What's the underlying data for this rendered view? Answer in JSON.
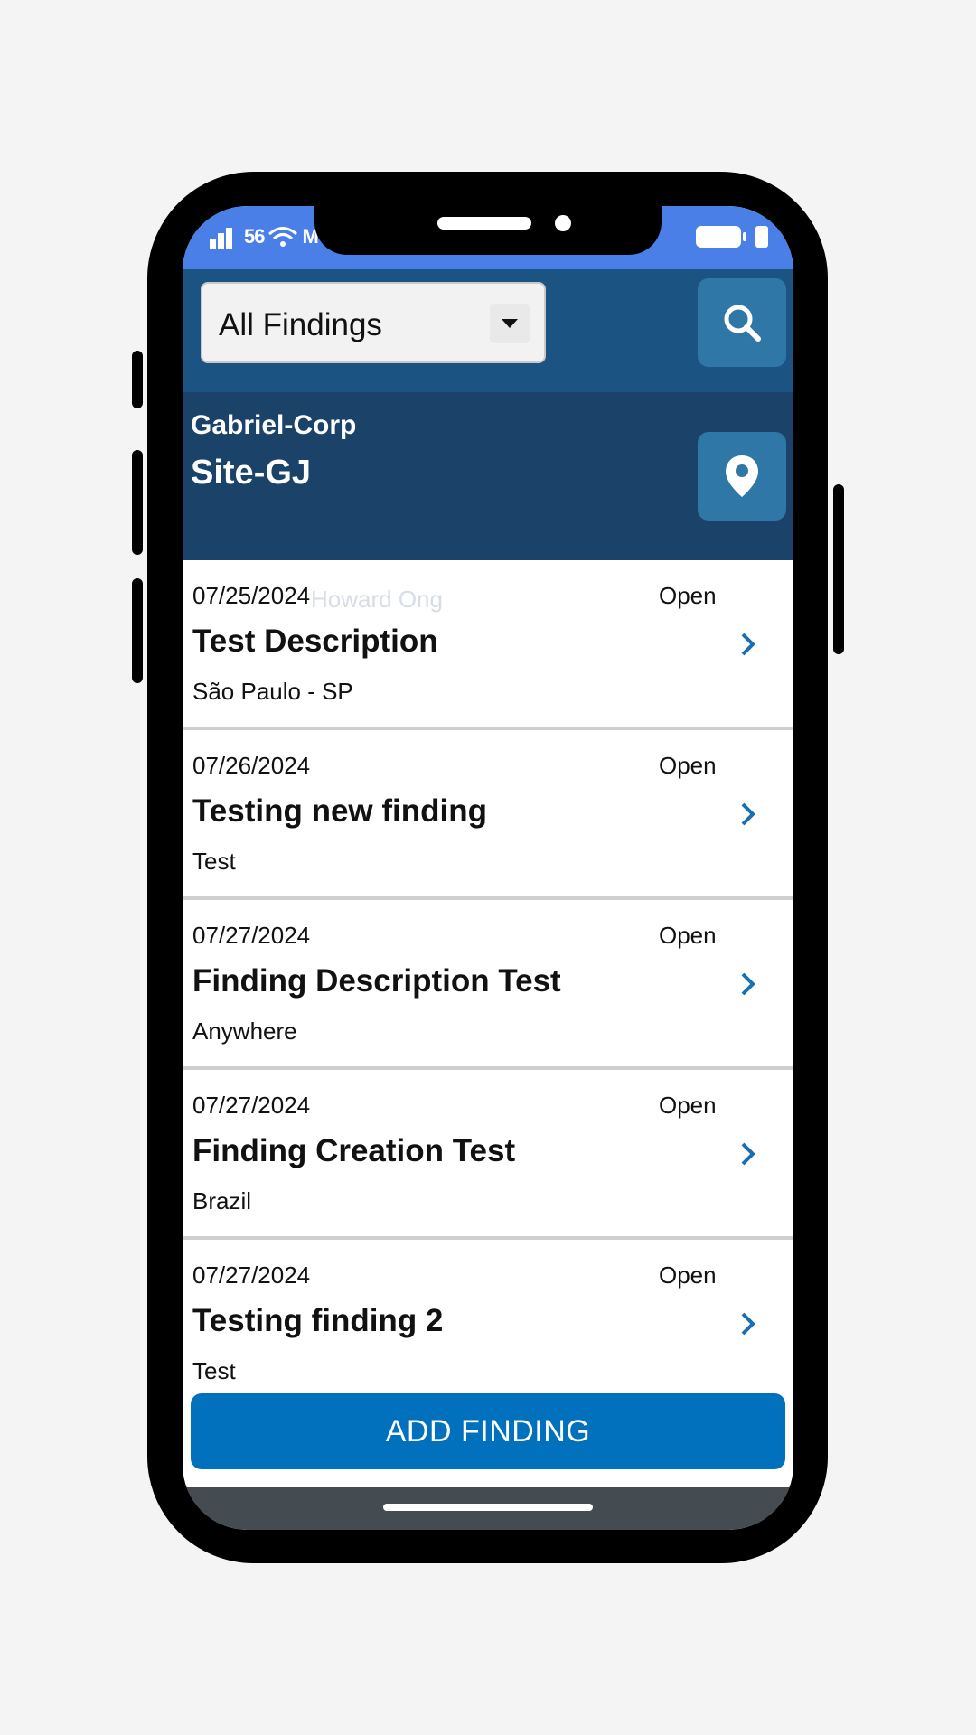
{
  "status_bar": {
    "time_fragment": "56",
    "network": "M"
  },
  "header": {
    "filter": {
      "selected": "All Findings"
    },
    "search_icon": "search-icon",
    "company": "Gabriel-Corp",
    "site": "Site-GJ",
    "location_icon": "map-pin-icon"
  },
  "findings": [
    {
      "date": "07/25/2024",
      "status": "Open",
      "title": "Test Description",
      "location": "São Paulo - SP"
    },
    {
      "date": "07/26/2024",
      "status": "Open",
      "title": "Testing new finding",
      "location": "Test"
    },
    {
      "date": "07/27/2024",
      "status": "Open",
      "title": "Finding Description Test",
      "location": "Anywhere"
    },
    {
      "date": "07/27/2024",
      "status": "Open",
      "title": "Finding Creation Test",
      "location": "Brazil"
    },
    {
      "date": "07/27/2024",
      "status": "Open",
      "title": "Testing finding 2",
      "location": "Test"
    }
  ],
  "watermark": "Howard Ong",
  "actions": {
    "add_finding": "ADD FINDING"
  },
  "colors": {
    "primary": "#0171bd",
    "header": "#1b5382",
    "site_header": "#1b4369",
    "status_bar": "#4b7fe8"
  }
}
